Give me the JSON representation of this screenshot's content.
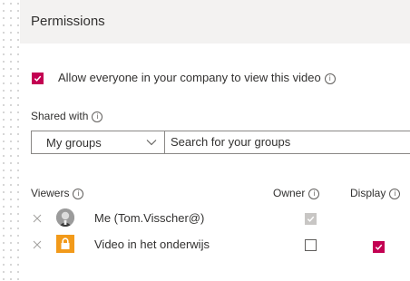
{
  "header": {
    "title": "Permissions"
  },
  "allow": {
    "label": "Allow everyone in your company to view this video",
    "checked": true,
    "info_icon": "info-icon"
  },
  "shared": {
    "label": "Shared with",
    "group_select": {
      "value": "My groups"
    },
    "search": {
      "placeholder": "Search for your groups",
      "value": ""
    }
  },
  "table": {
    "headers": {
      "viewers": "Viewers",
      "owner": "Owner",
      "display": "Display"
    },
    "rows": [
      {
        "name": "Me (Tom.Visscher@)",
        "icon": "user-avatar",
        "owner": "checked-disabled",
        "display": ""
      },
      {
        "name": "Video in het onderwijs",
        "icon": "lock-icon",
        "owner": "unchecked",
        "display": "checked"
      }
    ]
  },
  "colors": {
    "accent": "#c30052",
    "header_bg": "#f3f2f1",
    "lock_tile": "#f29a1a",
    "disabled_check": "#c8c6c4"
  }
}
